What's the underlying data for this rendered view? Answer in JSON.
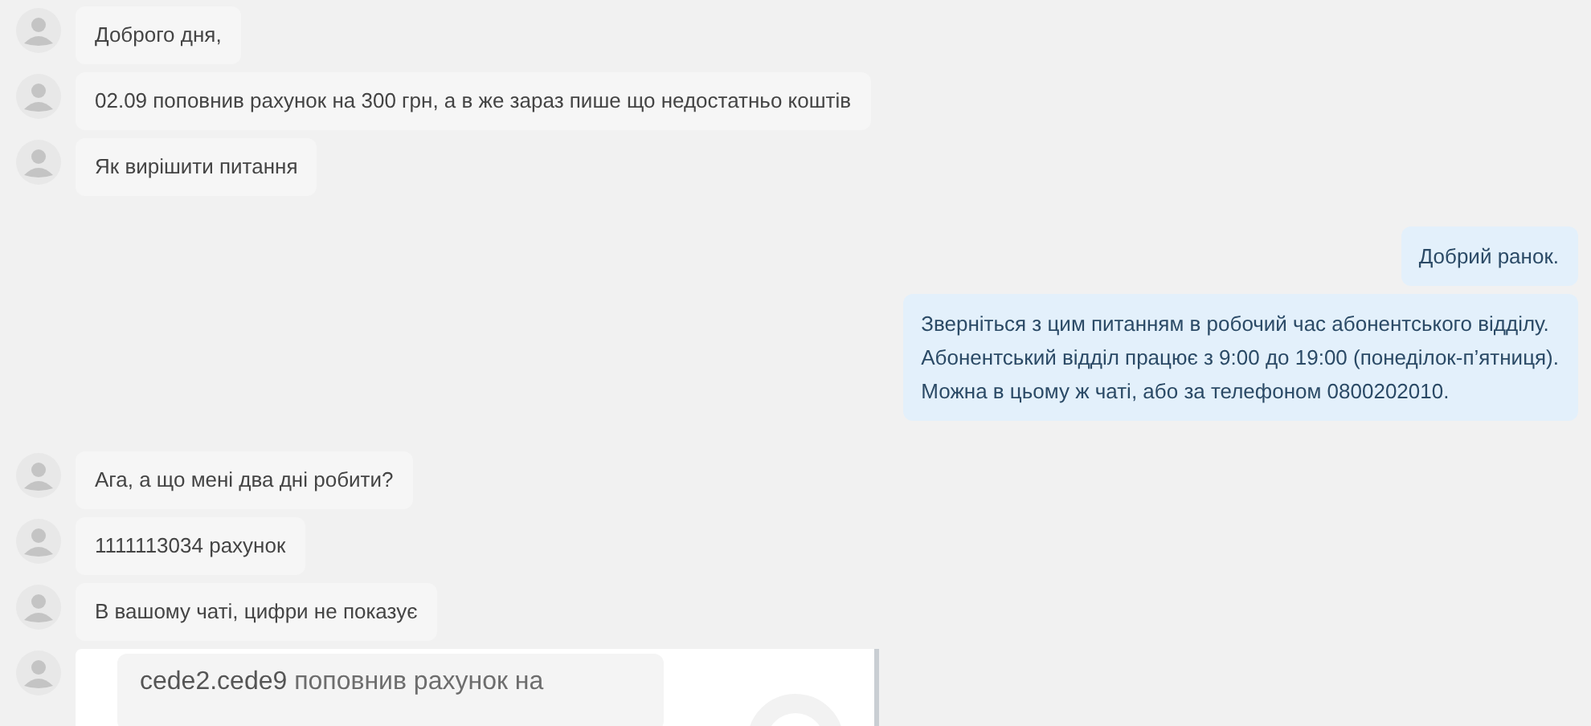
{
  "messages": [
    {
      "outgoing": false,
      "kind": "text",
      "lines": [
        "Доброго дня,"
      ]
    },
    {
      "outgoing": false,
      "kind": "text",
      "lines": [
        "02.09 поповнив рахунок на 300 грн, а в же зараз пише що недостатньо коштів"
      ]
    },
    {
      "outgoing": false,
      "kind": "text",
      "lines": [
        "Як вирішити питання"
      ]
    },
    {
      "outgoing": true,
      "kind": "text",
      "lines": [
        "Добрий ранок."
      ]
    },
    {
      "outgoing": true,
      "kind": "text",
      "lines": [
        "Зверніться з цим питанням в робочий час абонентського відділу.",
        "Абонентський відділ працює з 9:00 до 19:00 (понеділок-п’ятниця).",
        "Можна в цьому ж чаті, або за телефоном 0800202010."
      ]
    },
    {
      "outgoing": false,
      "kind": "text",
      "lines": [
        "Ага, а що мені два дні робити?"
      ]
    },
    {
      "outgoing": false,
      "kind": "text",
      "lines": [
        "1111113034 рахунок"
      ]
    },
    {
      "outgoing": false,
      "kind": "text",
      "lines": [
        "В вашому чаті, цифри не показує"
      ]
    },
    {
      "outgoing": false,
      "kind": "image",
      "lines": [
        "**cede2.cede9** поповнив рахунок на"
      ]
    }
  ]
}
